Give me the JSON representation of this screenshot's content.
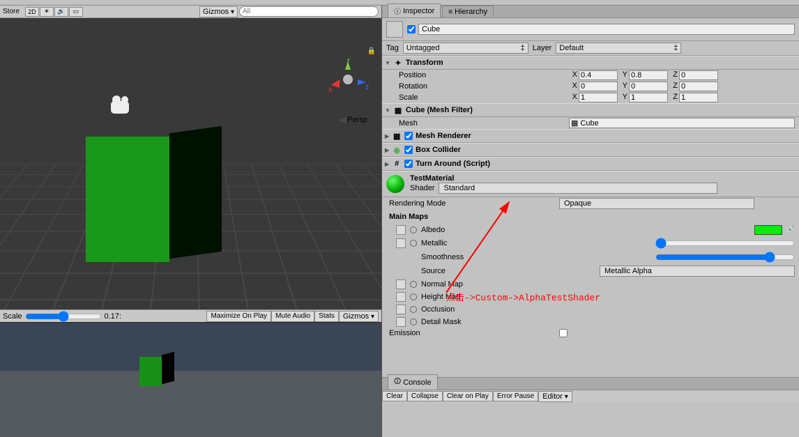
{
  "sceneBar": {
    "store": "Store",
    "btn2d": "2D",
    "gizmos": "Gizmos",
    "searchPlaceholder": "All"
  },
  "persp": "Persp",
  "scaleBar": {
    "label": "Scale",
    "value": "0.17:",
    "maximize": "Maximize On Play",
    "mute": "Mute Audio",
    "stats": "Stats",
    "gizmos": "Gizmos"
  },
  "tabs": {
    "inspector": "Inspector",
    "hierarchy": "Hierarchy"
  },
  "obj": {
    "name": "Cube",
    "tagLbl": "Tag",
    "tag": "Untagged",
    "layerLbl": "Layer",
    "layer": "Default"
  },
  "transform": {
    "title": "Transform",
    "posLbl": "Position",
    "rotLbl": "Rotation",
    "scaleLbl": "Scale",
    "px": "0.4",
    "py": "0.8",
    "pz": "0",
    "rx": "0",
    "ry": "0",
    "rz": "0",
    "sx": "1",
    "sy": "1",
    "sz": "1"
  },
  "meshFilter": {
    "title": "Cube (Mesh Filter)",
    "meshLbl": "Mesh",
    "mesh": "Cube"
  },
  "meshRenderer": {
    "title": "Mesh Renderer"
  },
  "boxCollider": {
    "title": "Box Collider"
  },
  "script": {
    "title": "Turn Around (Script)"
  },
  "material": {
    "name": "TestMaterial",
    "shaderLbl": "Shader",
    "shader": "Standard",
    "renderModeLbl": "Rendering Mode",
    "renderMode": "Opaque",
    "mainMaps": "Main Maps",
    "albedo": "Albedo",
    "metallic": "Metallic",
    "smoothness": "Smoothness",
    "source": "Source",
    "sourceVal": "Metallic Alpha",
    "normal": "Normal Map",
    "height": "Height Map",
    "occlusion": "Occlusion",
    "detail": "Detail Mask",
    "emission": "Emission"
  },
  "annotation": "点击->Custom->AlphaTestShader",
  "console": {
    "tab": "Console",
    "clear": "Clear",
    "collapse": "Collapse",
    "clearPlay": "Clear on Play",
    "errorPause": "Error Pause",
    "editor": "Editor"
  }
}
